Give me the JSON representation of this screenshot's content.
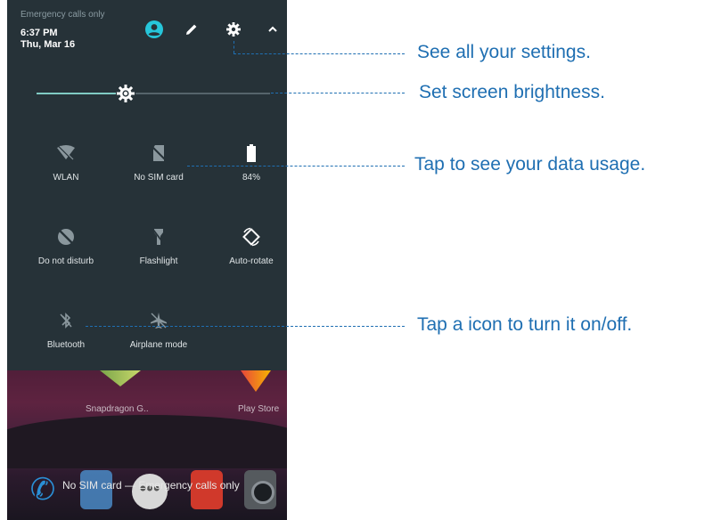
{
  "status": {
    "carrier": "Emergency calls only",
    "time": "6:37 PM",
    "date": "Thu, Mar 16"
  },
  "header_icons": [
    "user-icon",
    "edit-icon",
    "settings-icon",
    "chevron-up-icon"
  ],
  "brightness": {
    "level_fraction": 0.38
  },
  "tiles": [
    {
      "label": "WLAN",
      "icon": "wifi-off-icon"
    },
    {
      "label": "No SIM card",
      "icon": "no-sim-icon"
    },
    {
      "label": "84%",
      "icon": "battery-icon"
    },
    {
      "label": "Do not disturb",
      "icon": "dnd-icon"
    },
    {
      "label": "Flashlight",
      "icon": "flashlight-off-icon"
    },
    {
      "label": "Auto-rotate",
      "icon": "auto-rotate-icon"
    },
    {
      "label": "Bluetooth",
      "icon": "bluetooth-off-icon"
    },
    {
      "label": "Airplane mode",
      "icon": "airplane-off-icon"
    }
  ],
  "home": {
    "apps": [
      "Snapdragon G..",
      "Play Store"
    ],
    "bottom_status": "No SIM card — Emergency calls only"
  },
  "annotations": [
    "See all your settings.",
    "Set screen brightness.",
    "Tap to see your data usage.",
    "Tap a icon to turn it on/off."
  ],
  "colors": {
    "panel": "#263238",
    "accent": "#80cbc4",
    "user_icon": "#26c6da",
    "annotation": "#1f6fb2"
  }
}
